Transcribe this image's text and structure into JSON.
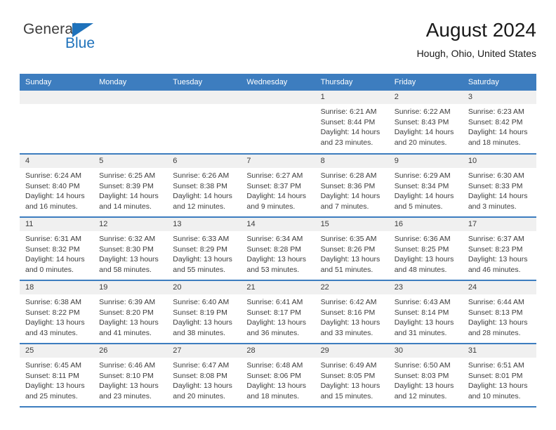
{
  "logo": {
    "word1": "General",
    "word2": "Blue",
    "triangle_color": "#1f72bb",
    "icon": "triangle-icon"
  },
  "header": {
    "title": "August 2024",
    "subtitle": "Hough, Ohio, United States"
  },
  "theme": {
    "header_blue": "#3d7dbf",
    "band_gray": "#f0f0f0",
    "text": "#3c3c3c"
  },
  "calendar": {
    "weekday_headers": [
      "Sunday",
      "Monday",
      "Tuesday",
      "Wednesday",
      "Thursday",
      "Friday",
      "Saturday"
    ],
    "weeks": [
      [
        {
          "day": "",
          "lines": []
        },
        {
          "day": "",
          "lines": []
        },
        {
          "day": "",
          "lines": []
        },
        {
          "day": "",
          "lines": []
        },
        {
          "day": "1",
          "lines": [
            "Sunrise: 6:21 AM",
            "Sunset: 8:44 PM",
            "Daylight: 14 hours",
            "and 23 minutes."
          ]
        },
        {
          "day": "2",
          "lines": [
            "Sunrise: 6:22 AM",
            "Sunset: 8:43 PM",
            "Daylight: 14 hours",
            "and 20 minutes."
          ]
        },
        {
          "day": "3",
          "lines": [
            "Sunrise: 6:23 AM",
            "Sunset: 8:42 PM",
            "Daylight: 14 hours",
            "and 18 minutes."
          ]
        }
      ],
      [
        {
          "day": "4",
          "lines": [
            "Sunrise: 6:24 AM",
            "Sunset: 8:40 PM",
            "Daylight: 14 hours",
            "and 16 minutes."
          ]
        },
        {
          "day": "5",
          "lines": [
            "Sunrise: 6:25 AM",
            "Sunset: 8:39 PM",
            "Daylight: 14 hours",
            "and 14 minutes."
          ]
        },
        {
          "day": "6",
          "lines": [
            "Sunrise: 6:26 AM",
            "Sunset: 8:38 PM",
            "Daylight: 14 hours",
            "and 12 minutes."
          ]
        },
        {
          "day": "7",
          "lines": [
            "Sunrise: 6:27 AM",
            "Sunset: 8:37 PM",
            "Daylight: 14 hours",
            "and 9 minutes."
          ]
        },
        {
          "day": "8",
          "lines": [
            "Sunrise: 6:28 AM",
            "Sunset: 8:36 PM",
            "Daylight: 14 hours",
            "and 7 minutes."
          ]
        },
        {
          "day": "9",
          "lines": [
            "Sunrise: 6:29 AM",
            "Sunset: 8:34 PM",
            "Daylight: 14 hours",
            "and 5 minutes."
          ]
        },
        {
          "day": "10",
          "lines": [
            "Sunrise: 6:30 AM",
            "Sunset: 8:33 PM",
            "Daylight: 14 hours",
            "and 3 minutes."
          ]
        }
      ],
      [
        {
          "day": "11",
          "lines": [
            "Sunrise: 6:31 AM",
            "Sunset: 8:32 PM",
            "Daylight: 14 hours",
            "and 0 minutes."
          ]
        },
        {
          "day": "12",
          "lines": [
            "Sunrise: 6:32 AM",
            "Sunset: 8:30 PM",
            "Daylight: 13 hours",
            "and 58 minutes."
          ]
        },
        {
          "day": "13",
          "lines": [
            "Sunrise: 6:33 AM",
            "Sunset: 8:29 PM",
            "Daylight: 13 hours",
            "and 55 minutes."
          ]
        },
        {
          "day": "14",
          "lines": [
            "Sunrise: 6:34 AM",
            "Sunset: 8:28 PM",
            "Daylight: 13 hours",
            "and 53 minutes."
          ]
        },
        {
          "day": "15",
          "lines": [
            "Sunrise: 6:35 AM",
            "Sunset: 8:26 PM",
            "Daylight: 13 hours",
            "and 51 minutes."
          ]
        },
        {
          "day": "16",
          "lines": [
            "Sunrise: 6:36 AM",
            "Sunset: 8:25 PM",
            "Daylight: 13 hours",
            "and 48 minutes."
          ]
        },
        {
          "day": "17",
          "lines": [
            "Sunrise: 6:37 AM",
            "Sunset: 8:23 PM",
            "Daylight: 13 hours",
            "and 46 minutes."
          ]
        }
      ],
      [
        {
          "day": "18",
          "lines": [
            "Sunrise: 6:38 AM",
            "Sunset: 8:22 PM",
            "Daylight: 13 hours",
            "and 43 minutes."
          ]
        },
        {
          "day": "19",
          "lines": [
            "Sunrise: 6:39 AM",
            "Sunset: 8:20 PM",
            "Daylight: 13 hours",
            "and 41 minutes."
          ]
        },
        {
          "day": "20",
          "lines": [
            "Sunrise: 6:40 AM",
            "Sunset: 8:19 PM",
            "Daylight: 13 hours",
            "and 38 minutes."
          ]
        },
        {
          "day": "21",
          "lines": [
            "Sunrise: 6:41 AM",
            "Sunset: 8:17 PM",
            "Daylight: 13 hours",
            "and 36 minutes."
          ]
        },
        {
          "day": "22",
          "lines": [
            "Sunrise: 6:42 AM",
            "Sunset: 8:16 PM",
            "Daylight: 13 hours",
            "and 33 minutes."
          ]
        },
        {
          "day": "23",
          "lines": [
            "Sunrise: 6:43 AM",
            "Sunset: 8:14 PM",
            "Daylight: 13 hours",
            "and 31 minutes."
          ]
        },
        {
          "day": "24",
          "lines": [
            "Sunrise: 6:44 AM",
            "Sunset: 8:13 PM",
            "Daylight: 13 hours",
            "and 28 minutes."
          ]
        }
      ],
      [
        {
          "day": "25",
          "lines": [
            "Sunrise: 6:45 AM",
            "Sunset: 8:11 PM",
            "Daylight: 13 hours",
            "and 25 minutes."
          ]
        },
        {
          "day": "26",
          "lines": [
            "Sunrise: 6:46 AM",
            "Sunset: 8:10 PM",
            "Daylight: 13 hours",
            "and 23 minutes."
          ]
        },
        {
          "day": "27",
          "lines": [
            "Sunrise: 6:47 AM",
            "Sunset: 8:08 PM",
            "Daylight: 13 hours",
            "and 20 minutes."
          ]
        },
        {
          "day": "28",
          "lines": [
            "Sunrise: 6:48 AM",
            "Sunset: 8:06 PM",
            "Daylight: 13 hours",
            "and 18 minutes."
          ]
        },
        {
          "day": "29",
          "lines": [
            "Sunrise: 6:49 AM",
            "Sunset: 8:05 PM",
            "Daylight: 13 hours",
            "and 15 minutes."
          ]
        },
        {
          "day": "30",
          "lines": [
            "Sunrise: 6:50 AM",
            "Sunset: 8:03 PM",
            "Daylight: 13 hours",
            "and 12 minutes."
          ]
        },
        {
          "day": "31",
          "lines": [
            "Sunrise: 6:51 AM",
            "Sunset: 8:01 PM",
            "Daylight: 13 hours",
            "and 10 minutes."
          ]
        }
      ]
    ]
  }
}
